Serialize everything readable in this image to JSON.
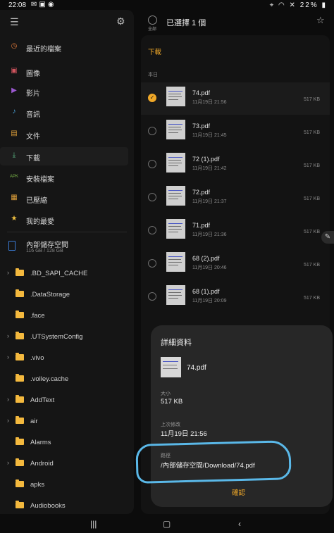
{
  "status_bar": {
    "time": "22:08",
    "battery": "22%"
  },
  "drawer": {
    "items": [
      {
        "label": "最近的檔案",
        "icon": "clock-icon",
        "color": "#e07a3a",
        "glyph": "◷"
      },
      {
        "label": "圖像",
        "icon": "image-icon",
        "color": "#d0545e",
        "glyph": "▣"
      },
      {
        "label": "影片",
        "icon": "video-icon",
        "color": "#9b59d0",
        "glyph": "▶"
      },
      {
        "label": "音訊",
        "icon": "music-icon",
        "color": "#4aa7e0",
        "glyph": "♪"
      },
      {
        "label": "文件",
        "icon": "document-icon",
        "color": "#e0a13a",
        "glyph": "▤"
      },
      {
        "label": "下載",
        "icon": "download-icon",
        "color": "#5fc08a",
        "glyph": "⤓"
      },
      {
        "label": "安裝檔案",
        "icon": "apk-icon",
        "color": "#7ab648",
        "glyph": "APK"
      },
      {
        "label": "已壓縮",
        "icon": "archive-icon",
        "color": "#e0a13a",
        "glyph": "▦"
      },
      {
        "label": "我的最愛",
        "icon": "star-icon",
        "color": "#f0c040",
        "glyph": "★"
      }
    ],
    "storage": {
      "name": "內部儲存空間",
      "size": "116 GB / 128 GB"
    },
    "folders": [
      {
        "name": ".BD_SAPI_CACHE",
        "expandable": true
      },
      {
        "name": ".DataStorage",
        "expandable": false
      },
      {
        "name": ".face",
        "expandable": false
      },
      {
        "name": ".UTSystemConfig",
        "expandable": true
      },
      {
        "name": ".vivo",
        "expandable": true
      },
      {
        "name": ".volley.cache",
        "expandable": false
      },
      {
        "name": "AddText",
        "expandable": true
      },
      {
        "name": "air",
        "expandable": true
      },
      {
        "name": "Alarms",
        "expandable": false
      },
      {
        "name": "Android",
        "expandable": true
      },
      {
        "name": "apks",
        "expandable": false
      },
      {
        "name": "Audiobooks",
        "expandable": false
      }
    ]
  },
  "topbar": {
    "select_all": "全部",
    "title": "已選擇 1 個"
  },
  "list": {
    "breadcrumb": "下載",
    "section": "本日",
    "files": [
      {
        "name": "74.pdf",
        "date": "11月19日 21:56",
        "size": "517 KB",
        "selected": true
      },
      {
        "name": "73.pdf",
        "date": "11月19日 21:45",
        "size": "517 KB",
        "selected": false
      },
      {
        "name": "72 (1).pdf",
        "date": "11月19日 21:42",
        "size": "517 KB",
        "selected": false
      },
      {
        "name": "72.pdf",
        "date": "11月19日 21:37",
        "size": "517 KB",
        "selected": false
      },
      {
        "name": "71.pdf",
        "date": "11月19日 21:36",
        "size": "517 KB",
        "selected": false
      },
      {
        "name": "68 (2).pdf",
        "date": "11月19日 20:46",
        "size": "517 KB",
        "selected": false
      },
      {
        "name": "68 (1).pdf",
        "date": "11月19日 20:09",
        "size": "517 KB",
        "selected": false
      }
    ]
  },
  "dialog": {
    "title": "詳細資料",
    "file_name": "74.pdf",
    "size_label": "大小",
    "size_value": "517 KB",
    "modified_label": "上次修改",
    "modified_value": "11月19日 21:56",
    "path_label": "路徑",
    "path_value": "/內部儲存空間/Download/74.pdf",
    "ok_label": "確認"
  },
  "accent_color": "#f0a828",
  "highlight_color": "#5ab8e8"
}
